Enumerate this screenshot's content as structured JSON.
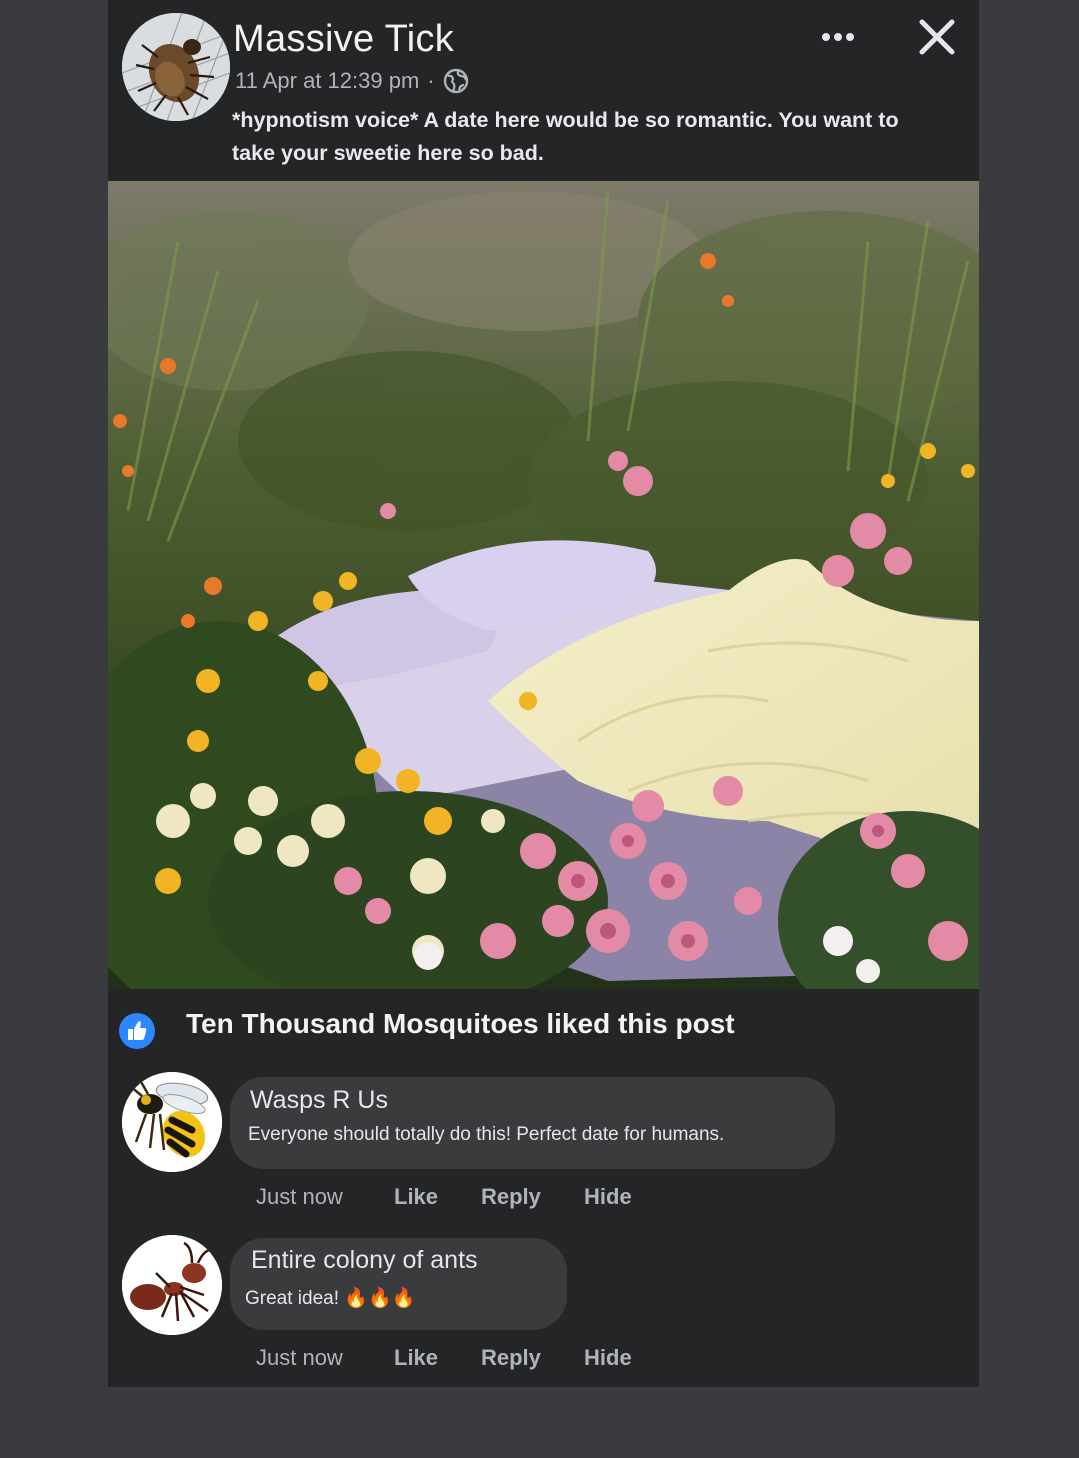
{
  "post": {
    "author": "Massive Tick",
    "timestamp": "11 Apr at 12:39 pm",
    "separator": "·",
    "privacy_icon": "globe-icon",
    "text": "*hypnotism voice* A date here would be so romantic. You want to take your sweetie here so bad.",
    "more_icon": "more-horizontal-icon",
    "close_icon": "close-icon"
  },
  "likes": {
    "icon": "thumbs-up-icon",
    "text": "Ten Thousand Mosquitoes liked this post"
  },
  "comments": [
    {
      "author": "Wasps R Us",
      "text": "Everyone should totally do this! Perfect date for  humans.",
      "time": "Just now",
      "like": "Like",
      "reply": "Reply",
      "hide": "Hide"
    },
    {
      "author": "Entire colony of ants",
      "text": "Great idea!",
      "emoji": "🔥🔥🔥",
      "time": "Just now",
      "like": "Like",
      "reply": "Reply",
      "hide": "Hide"
    }
  ],
  "colors": {
    "page_bg": "#3a3b3f",
    "card_bg": "#242527",
    "bubble_bg": "#3a3b3c",
    "like_blue": "#2d88ff",
    "secondary_text": "#b0b3b8"
  }
}
